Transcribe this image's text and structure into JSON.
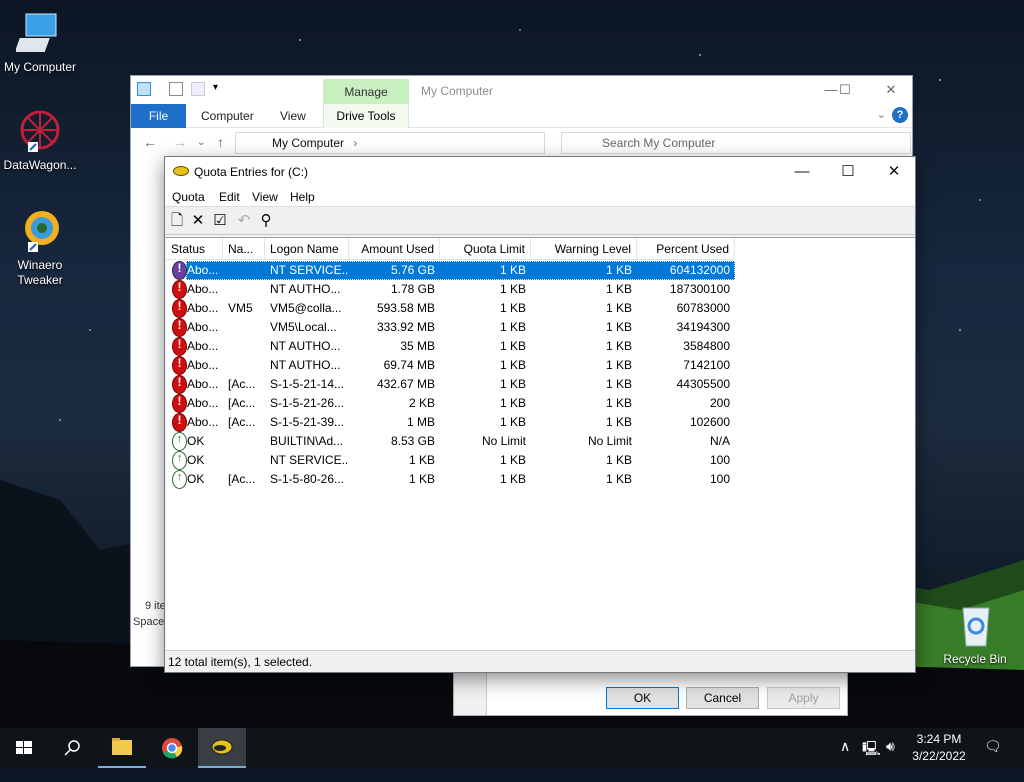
{
  "desktop": {
    "icons": [
      {
        "label": "My Computer"
      },
      {
        "label": "DataWagon..."
      },
      {
        "label": "Winaero Tweaker"
      },
      {
        "label": "Recycle Bin"
      }
    ]
  },
  "explorer": {
    "title": "My Computer",
    "manage_tab": "Manage",
    "tabs": [
      "File",
      "Computer",
      "View",
      "Drive Tools"
    ],
    "address": "My Computer",
    "search_placeholder": "Search My Computer",
    "status_items": "9 ite",
    "status_space": "Space"
  },
  "properties_dialog": {
    "ok": "OK",
    "cancel": "Cancel",
    "apply": "Apply"
  },
  "quota": {
    "title": "Quota Entries for  (C:)",
    "menu": [
      "Quota",
      "Edit",
      "View",
      "Help"
    ],
    "toolbar_icons": [
      "new-entry-icon",
      "delete-icon",
      "properties-icon",
      "undo-icon",
      "find-icon"
    ],
    "columns": [
      "Status",
      "Na...",
      "Logon Name",
      "Amount Used",
      "Quota Limit",
      "Warning Level",
      "Percent Used"
    ],
    "rows": [
      {
        "status": "Abo...",
        "name": "",
        "logon": "NT SERVICE...",
        "amount": "5.76 GB",
        "limit": "1 KB",
        "warning": "1 KB",
        "percent": "604132000",
        "icon": "warning-selected",
        "selected": true
      },
      {
        "status": "Abo...",
        "name": "",
        "logon": "NT AUTHO...",
        "amount": "1.78 GB",
        "limit": "1 KB",
        "warning": "1 KB",
        "percent": "187300100",
        "icon": "warning"
      },
      {
        "status": "Abo...",
        "name": "VM5",
        "logon": "VM5@colla...",
        "amount": "593.58 MB",
        "limit": "1 KB",
        "warning": "1 KB",
        "percent": "60783000",
        "icon": "warning"
      },
      {
        "status": "Abo...",
        "name": "",
        "logon": "VM5\\Local...",
        "amount": "333.92 MB",
        "limit": "1 KB",
        "warning": "1 KB",
        "percent": "34194300",
        "icon": "warning"
      },
      {
        "status": "Abo...",
        "name": "",
        "logon": "NT AUTHO...",
        "amount": "35 MB",
        "limit": "1 KB",
        "warning": "1 KB",
        "percent": "3584800",
        "icon": "warning"
      },
      {
        "status": "Abo...",
        "name": "",
        "logon": "NT AUTHO...",
        "amount": "69.74 MB",
        "limit": "1 KB",
        "warning": "1 KB",
        "percent": "7142100",
        "icon": "warning"
      },
      {
        "status": "Abo...",
        "name": "[Ac...",
        "logon": "S-1-5-21-14...",
        "amount": "432.67 MB",
        "limit": "1 KB",
        "warning": "1 KB",
        "percent": "44305500",
        "icon": "warning"
      },
      {
        "status": "Abo...",
        "name": "[Ac...",
        "logon": "S-1-5-21-26...",
        "amount": "2 KB",
        "limit": "1 KB",
        "warning": "1 KB",
        "percent": "200",
        "icon": "warning"
      },
      {
        "status": "Abo...",
        "name": "[Ac...",
        "logon": "S-1-5-21-39...",
        "amount": "1 MB",
        "limit": "1 KB",
        "warning": "1 KB",
        "percent": "102600",
        "icon": "warning"
      },
      {
        "status": "OK",
        "name": "",
        "logon": "BUILTIN\\Ad...",
        "amount": "8.53 GB",
        "limit": "No Limit",
        "warning": "No Limit",
        "percent": "N/A",
        "icon": "ok"
      },
      {
        "status": "OK",
        "name": "",
        "logon": "NT SERVICE...",
        "amount": "1 KB",
        "limit": "1 KB",
        "warning": "1 KB",
        "percent": "100",
        "icon": "ok"
      },
      {
        "status": "OK",
        "name": "[Ac...",
        "logon": "S-1-5-80-26...",
        "amount": "1 KB",
        "limit": "1 KB",
        "warning": "1 KB",
        "percent": "100",
        "icon": "ok"
      }
    ],
    "status_bar": "12 total item(s), 1 selected."
  },
  "taskbar": {
    "time": "3:24 PM",
    "date": "3/22/2022"
  }
}
